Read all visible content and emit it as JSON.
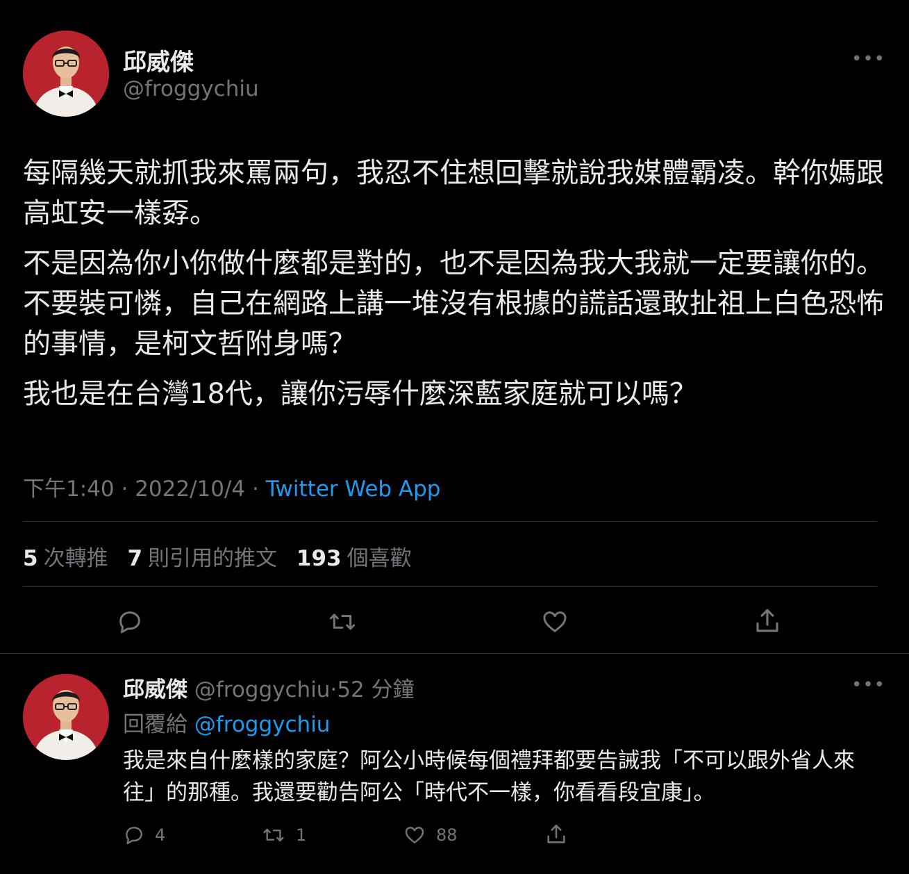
{
  "main_tweet": {
    "author_name": "邱威傑",
    "author_handle": "@froggychiu",
    "paragraphs": [
      "每隔幾天就抓我來罵兩句，我忍不住想回擊就說我媒體霸凌。幹你媽跟高虹安一樣孬。",
      "不是因為你小你做什麼都是對的，也不是因為我大我就一定要讓你的。不要裝可憐，自己在網路上講一堆沒有根據的謊話還敢扯祖上白色恐怖的事情，是柯文哲附身嗎？",
      "我也是在台灣18代，讓你污辱什麼深藍家庭就可以嗎？"
    ],
    "time": "下午1:40",
    "date": "2022/10/4",
    "separator": "·",
    "source": "Twitter Web App",
    "stats": {
      "retweets_count": "5",
      "retweets_label": "次轉推",
      "quotes_count": "7",
      "quotes_label": "則引用的推文",
      "likes_count": "193",
      "likes_label": "個喜歡"
    }
  },
  "reply_tweet": {
    "author_name": "邱威傑",
    "author_handle": "@froggychiu",
    "separator": "·",
    "time_ago": "52 分鐘",
    "replying_to_label": "回覆給",
    "replying_to_handle": "@froggychiu",
    "text": "我是來自什麼樣的家庭？阿公小時候每個禮拜都要告誡我「不可以跟外省人來往」的那種。我還要勸告阿公「時代不一樣，你看看段宜康」。",
    "counts": {
      "replies": "4",
      "retweets": "1",
      "likes": "88"
    }
  },
  "icons": {
    "more": "more-horizontal-icon",
    "reply": "reply-bubble-icon",
    "retweet": "retweet-icon",
    "like": "heart-icon",
    "share": "share-icon"
  },
  "colors": {
    "background": "#000000",
    "text": "#e7e9ea",
    "muted": "#71767b",
    "accent": "#1d9bf0",
    "divider": "#2f3336",
    "avatar_bg": "#b8232d"
  }
}
